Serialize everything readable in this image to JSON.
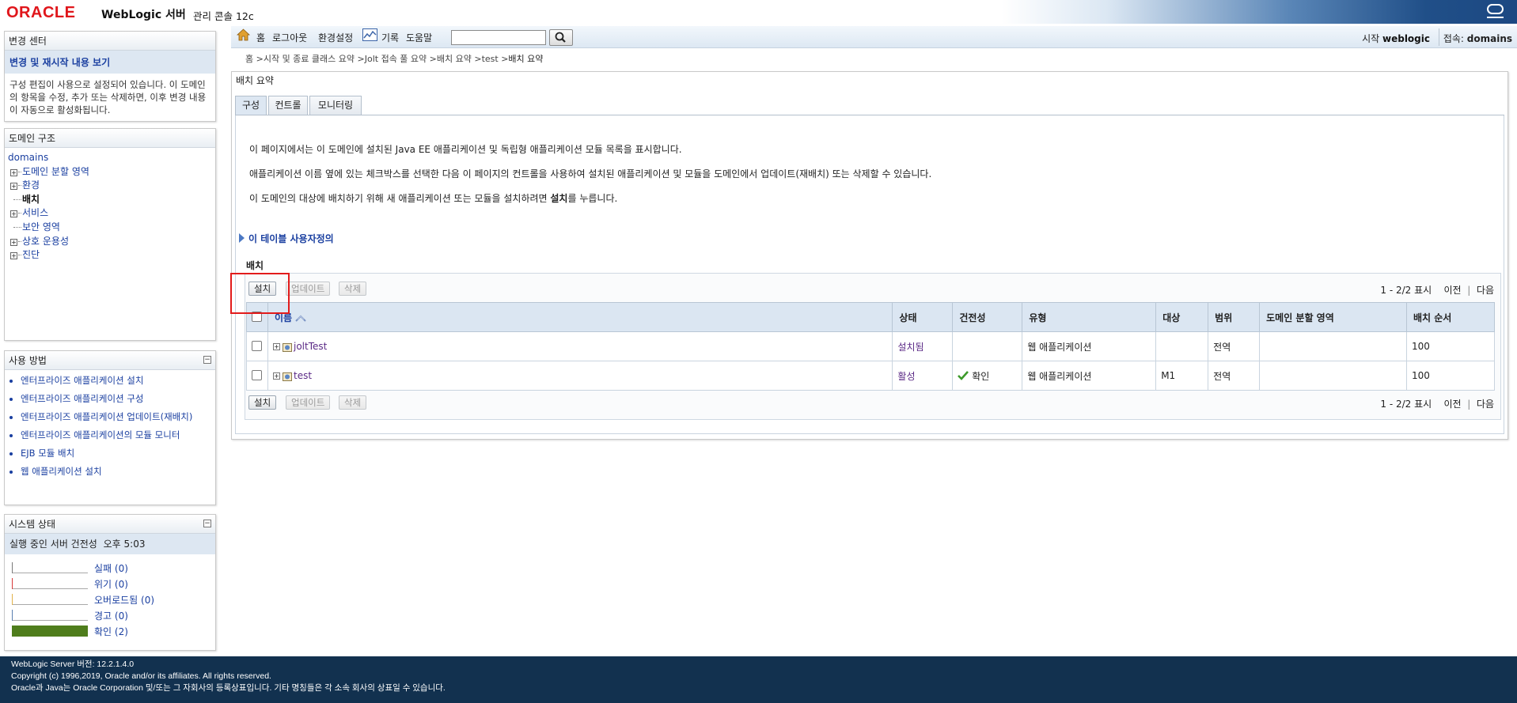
{
  "header": {
    "logo": "ORACLE",
    "product": "WebLogic 서버",
    "product_sub": "관리 콘솔 12c"
  },
  "change_center": {
    "title": "변경 센터",
    "link": "변경 및 재시작 내용 보기",
    "text": "구성 편집이 사용으로 설정되어 있습니다. 이 도메인의 항목을 수정, 추가 또는 삭제하면, 이후 변경 내용이 자동으로 활성화됩니다."
  },
  "domain_structure": {
    "title": "도메인 구조",
    "root": "domains",
    "items": [
      {
        "label": "도메인 분할 영역",
        "expandable": true,
        "selected": false
      },
      {
        "label": "환경",
        "expandable": true,
        "selected": false
      },
      {
        "label": "배치",
        "expandable": false,
        "selected": true
      },
      {
        "label": "서비스",
        "expandable": true,
        "selected": false
      },
      {
        "label": "보안 영역",
        "expandable": false,
        "selected": false
      },
      {
        "label": "상호 운용성",
        "expandable": true,
        "selected": false
      },
      {
        "label": "진단",
        "expandable": true,
        "selected": false
      }
    ]
  },
  "usage": {
    "title": "사용 방법",
    "items": [
      "엔터프라이즈 애플리케이션 설치",
      "엔터프라이즈 애플리케이션 구성",
      "엔터프라이즈 애플리케이션 업데이트(재배치)",
      "엔터프라이즈 애플리케이션의 모듈 모니터",
      "EJB 모듈 배치",
      "웹 애플리케이션 설치"
    ]
  },
  "system_status": {
    "title": "시스템 상태",
    "subtitle": "실행 중인 서버 건전성",
    "time": "오후 5:03",
    "rows": [
      {
        "label": "실패 (0)",
        "count": 0,
        "color": "#7a7a7a"
      },
      {
        "label": "위기 (0)",
        "count": 0,
        "color": "#d83a3a"
      },
      {
        "label": "오버로드됨 (0)",
        "count": 0,
        "color": "#e3b24a"
      },
      {
        "label": "경고 (0)",
        "count": 0,
        "color": "#5a80b0"
      },
      {
        "label": "확인 (2)",
        "count": 2,
        "color": "#4f7d1c"
      }
    ]
  },
  "toolbar": {
    "home": "홈",
    "logout": "로그아웃",
    "preferences": "환경설정",
    "record": "기록",
    "help": "도움말",
    "search_value": "",
    "welcome_prefix": "시작",
    "welcome_user": "weblogic",
    "connected_prefix": "접속:",
    "connected_domain": "domains"
  },
  "breadcrumb": {
    "path": "홈 >시작 및 종료 클래스 요약 >Jolt 접속 풀 요약 >배치 요약 >test >",
    "current": "배치 요약"
  },
  "main": {
    "title": "배치 요약",
    "tabs": [
      "구성",
      "컨트롤",
      "모니터링"
    ],
    "desc1": "이 페이지에서는 이 도메인에 설치된 Java EE 애플리케이션 및 독립형 애플리케이션 모듈 목록을 표시합니다.",
    "desc2": "애플리케이션 이름 옆에 있는 체크박스를 선택한 다음 이 페이지의 컨트롤을 사용하여 설치된 애플리케이션 및 모듈을 도메인에서 업데이트(재배치) 또는 삭제할 수 있습니다.",
    "desc3_pre": "이 도메인의 대상에 배치하기 위해 새 애플리케이션 또는 모듈을 설치하려면 ",
    "desc3_bold": "설치",
    "desc3_post": "를 누릅니다.",
    "customize": "이 테이블 사용자정의",
    "deploy_label": "배치",
    "buttons": {
      "install": "설치",
      "update": "업데이트",
      "delete": "삭제"
    },
    "pager": {
      "range": "1 - 2/2 표시",
      "prev": "이전",
      "next": "다음"
    },
    "columns": [
      "이름",
      "상태",
      "건전성",
      "유형",
      "대상",
      "범위",
      "도메인 분할 영역",
      "배치 순서"
    ],
    "rows": [
      {
        "name": "joltTest",
        "state": "설치됨",
        "health": "",
        "type": "웹 애플리케이션",
        "target": "",
        "scope": "전역",
        "partition": "",
        "order": "100"
      },
      {
        "name": "test",
        "state": "활성",
        "health": "확인",
        "type": "웹 애플리케이션",
        "target": "M1",
        "scope": "전역",
        "partition": "",
        "order": "100"
      }
    ]
  },
  "footer": {
    "line1": "WebLogic Server 버전: 12.2.1.4.0",
    "line2": "Copyright (c) 1996,2019, Oracle and/or its affiliates. All rights reserved.",
    "line3": "Oracle과 Java는 Oracle Corporation 및/또는 그 자회사의 등록상표입니다. 기타 명칭들은 각 소속 회사의 상표일 수 있습니다."
  },
  "colors": {
    "header_dark": "#1c4882",
    "footer": "#12314f",
    "link": "#1a3fa0",
    "highlight": "#e21b1b",
    "ok_green": "#4f7d1c"
  }
}
